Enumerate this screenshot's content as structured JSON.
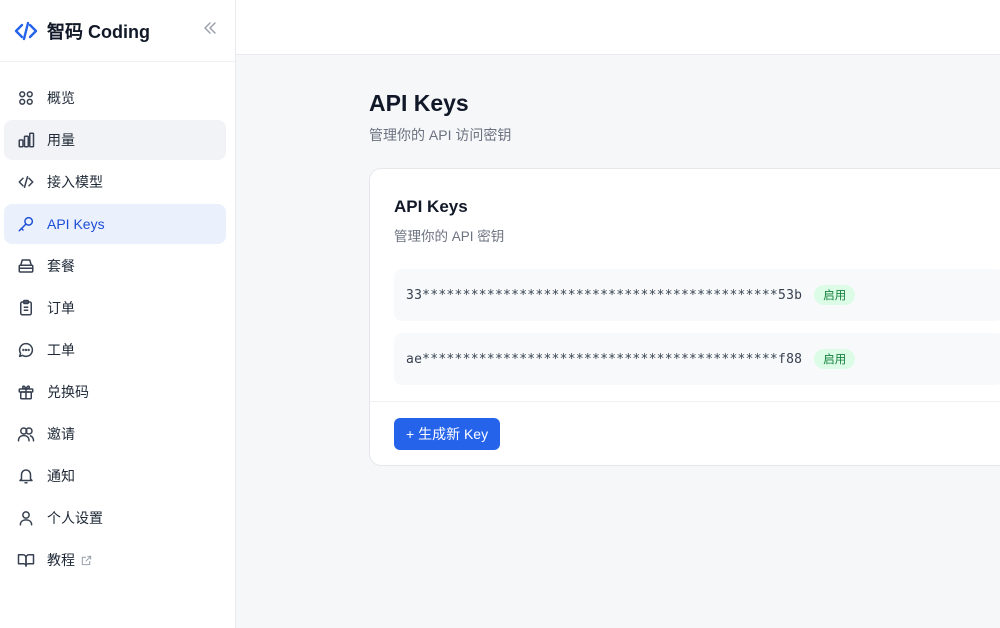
{
  "brand": {
    "name": "智码 Coding",
    "logo_icon": "code-brand-icon",
    "collapse_icon": "double-chevron-left-icon",
    "accent": "#2563eb"
  },
  "sidebar": {
    "items": [
      {
        "label": "概览",
        "icon": "grid-icon"
      },
      {
        "label": "用量",
        "icon": "bar-chart-icon"
      },
      {
        "label": "接入模型",
        "icon": "code-icon"
      },
      {
        "label": "API Keys",
        "icon": "key-icon"
      },
      {
        "label": "套餐",
        "icon": "package-icon"
      },
      {
        "label": "订单",
        "icon": "clipboard-icon"
      },
      {
        "label": "工单",
        "icon": "message-circle-icon"
      },
      {
        "label": "兑换码",
        "icon": "gift-icon"
      },
      {
        "label": "邀请",
        "icon": "users-icon"
      },
      {
        "label": "通知",
        "icon": "bell-icon"
      },
      {
        "label": "个人设置",
        "icon": "user-icon"
      },
      {
        "label": "教程",
        "icon": "book-icon",
        "external": true
      }
    ],
    "active_index": 3,
    "hover_index": 1
  },
  "page": {
    "title": "API Keys",
    "subtitle": "管理你的 API 访问密钥"
  },
  "card": {
    "title": "API Keys",
    "subtitle": "管理你的 API 密钥",
    "keys": [
      {
        "masked": "33********************************************53b",
        "status": "启用"
      },
      {
        "masked": "ae********************************************f88",
        "status": "启用"
      }
    ],
    "create_button": "+ 生成新 Key"
  },
  "colors": {
    "active_bg": "#eaf0fc",
    "active_text": "#1d4ed8",
    "badge_bg": "#dcfce7",
    "badge_text": "#15803d"
  }
}
